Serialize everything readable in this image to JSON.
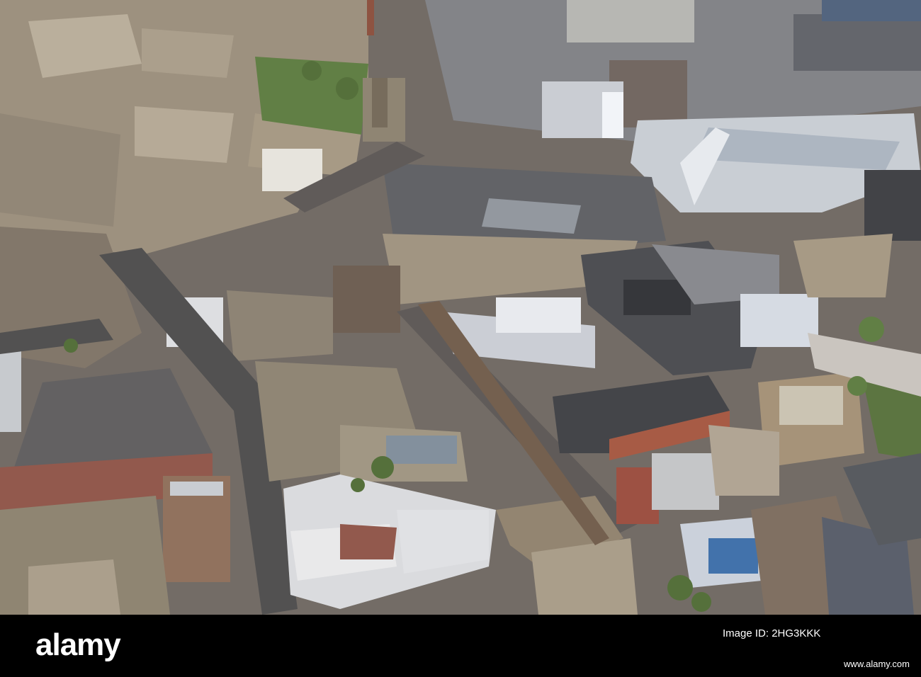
{
  "photo": {
    "description_alt": "Aerial view of a town centre",
    "palette": {
      "stone": "#8c8070",
      "stone_light": "#b9ad99",
      "roof_dark": "#3e3f45",
      "roof_grey": "#6b6e75",
      "road": "#4b4a4a",
      "shadow": "#2b2a2d",
      "grass": "#5b7a3e",
      "white_roof": "#d9dde3",
      "red_brick": "#9a4a3c"
    }
  },
  "watermark": {
    "brand": "alamy",
    "image_id_label": "Image ID: 2HG3KKK",
    "image_id_code": "2HG3KKK",
    "url": "www.alamy.com"
  }
}
